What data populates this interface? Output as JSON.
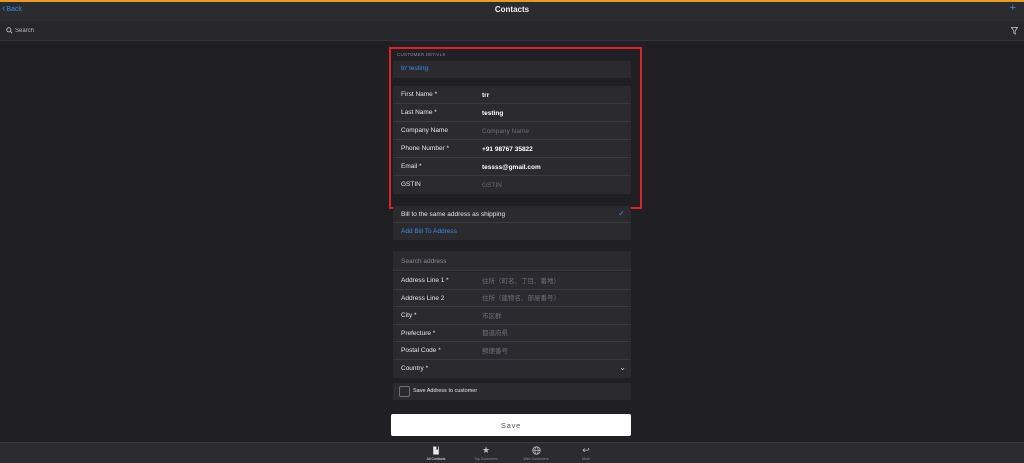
{
  "header": {
    "back_label": "Back",
    "title": "Contacts",
    "add_label": "+"
  },
  "search": {
    "placeholder": "Search"
  },
  "section": {
    "label": "CUSTOMER DETAILS",
    "display_name": "trr testing"
  },
  "fields": {
    "first_name": {
      "label": "First Name *",
      "value": "trr"
    },
    "last_name": {
      "label": "Last Name *",
      "value": "testing"
    },
    "company": {
      "label": "Company Name",
      "placeholder": "Company Name"
    },
    "phone": {
      "label": "Phone Number *",
      "value": "+91 98767 35822"
    },
    "email": {
      "label": "Email *",
      "value": "tessss@gmail.com"
    },
    "gstin": {
      "label": "GSTIN",
      "placeholder": "GSTIN"
    }
  },
  "billing": {
    "same_address_label": "Bill to the same address as shipping",
    "same_address_checked": true,
    "add_bill_label": "Add Bill To Address"
  },
  "address": {
    "search_placeholder": "Search address",
    "line1": {
      "label": "Address Line 1 *",
      "placeholder": "住所（町名、丁目、番地）"
    },
    "line2": {
      "label": "Address Line 2",
      "placeholder": "住所（建物名、部屋番号）"
    },
    "city": {
      "label": "City *",
      "placeholder": "市区群"
    },
    "prefecture": {
      "label": "Prefecture *",
      "placeholder": "都道府県"
    },
    "postal": {
      "label": "Postal Code *",
      "placeholder": "郵便番号"
    },
    "country": {
      "label": "Country *",
      "value": ""
    }
  },
  "save_address": {
    "label": "Save Address to customer",
    "checked": false
  },
  "save_button": "Save",
  "tabs": [
    {
      "label": "All Contacts",
      "icon": "book-icon",
      "active": true
    },
    {
      "label": "Top Customers",
      "icon": "star-icon",
      "active": false
    },
    {
      "label": "Web Customers",
      "icon": "globe-icon",
      "active": false
    },
    {
      "label": "More",
      "icon": "reply-icon",
      "active": false
    }
  ],
  "colors": {
    "accent": "#3a8ee6",
    "top_strip": "#e69a2a",
    "highlight_border": "#d6252b",
    "background": "#1f1f24"
  }
}
